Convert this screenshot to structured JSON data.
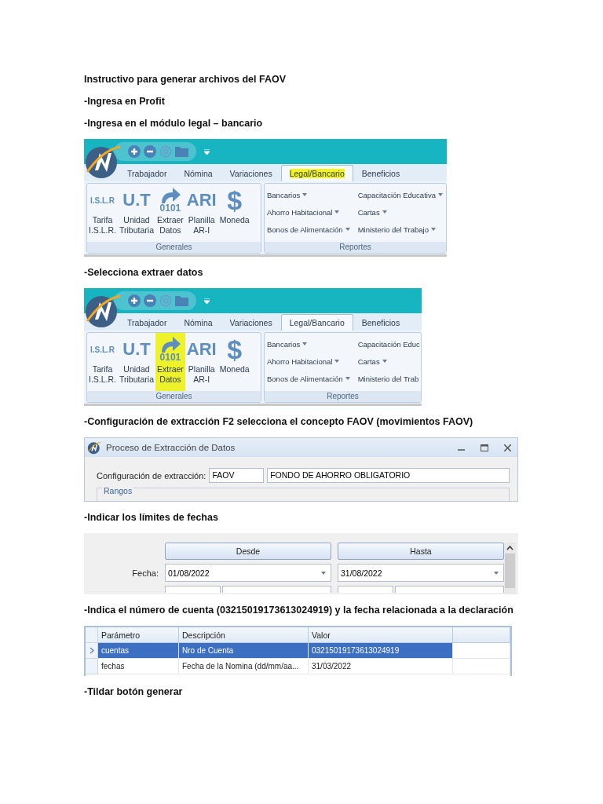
{
  "blocks": [
    {
      "kind": "text",
      "text": "Instructivo para generar archivos del FAOV"
    },
    {
      "kind": "text",
      "text": "-Ingresa en Profit"
    },
    {
      "kind": "text",
      "text": "-Ingresa en el módulo legal – bancario"
    },
    {
      "kind": "ribbon",
      "tabs": [
        {
          "label": "Trabajador",
          "selected": false,
          "highlighted": false
        },
        {
          "label": "Nómina",
          "selected": false,
          "highlighted": false
        },
        {
          "label": "Variaciones",
          "selected": false,
          "highlighted": false
        },
        {
          "label": "Legal/Bancario",
          "selected": true,
          "highlighted": true
        },
        {
          "label": "Beneficios",
          "selected": false,
          "highlighted": false
        }
      ],
      "tools_label": "Generales",
      "tools": [
        {
          "kind": "glyph",
          "glyph": "I.S.L.R",
          "lines": [
            "Tarifa",
            "I.S.L.R."
          ],
          "highlighted": false
        },
        {
          "kind": "glyph",
          "glyph": "U.T",
          "lines": [
            "Unidad",
            "Tributaria"
          ],
          "highlighted": false
        },
        {
          "kind": "arrow",
          "glyph": "0101",
          "lines": [
            "Extraer",
            "Datos"
          ],
          "highlighted": false
        },
        {
          "kind": "glyph",
          "glyph": "ARI",
          "lines": [
            "Planilla",
            "AR-I"
          ],
          "highlighted": false
        },
        {
          "kind": "glyph",
          "glyph": "$",
          "lines": [
            "Moneda"
          ],
          "highlighted": false
        }
      ],
      "menus_label": "Reportes",
      "menus": [
        {
          "label": "Bancarios",
          "dropdown": true
        },
        {
          "label": "Ahorro Habitacional",
          "dropdown": true
        },
        {
          "label": "Bonos de Alimentación",
          "dropdown": true
        },
        {
          "label": "Capacitación Educativa",
          "dropdown": true
        },
        {
          "label": "Cartas",
          "dropdown": true
        },
        {
          "label": "Ministerio del Trabajo",
          "dropdown": true
        }
      ]
    },
    {
      "kind": "text",
      "text": "-Selecciona extraer datos"
    },
    {
      "kind": "ribbon",
      "tabs": [
        {
          "label": "Trabajador",
          "selected": false,
          "highlighted": false
        },
        {
          "label": "Nómina",
          "selected": false,
          "highlighted": false
        },
        {
          "label": "Variaciones",
          "selected": false,
          "highlighted": false
        },
        {
          "label": "Legal/Bancario",
          "selected": true,
          "highlighted": false
        },
        {
          "label": "Beneficios",
          "selected": false,
          "highlighted": false
        }
      ],
      "tools_label": "Generales",
      "tools": [
        {
          "kind": "glyph",
          "glyph": "I.S.L.R",
          "lines": [
            "Tarifa",
            "I.S.L.R."
          ],
          "highlighted": false
        },
        {
          "kind": "glyph",
          "glyph": "U.T",
          "lines": [
            "Unidad",
            "Tributaria"
          ],
          "highlighted": false
        },
        {
          "kind": "arrow",
          "glyph": "0101",
          "lines": [
            "Extraer",
            "Datos"
          ],
          "highlighted": true
        },
        {
          "kind": "glyph",
          "glyph": "ARI",
          "lines": [
            "Planilla",
            "AR-I"
          ],
          "highlighted": false
        },
        {
          "kind": "glyph",
          "glyph": "$",
          "lines": [
            "Moneda"
          ],
          "highlighted": false
        }
      ],
      "menus_label": "Reportes",
      "menus": [
        {
          "label": "Bancarios",
          "dropdown": true
        },
        {
          "label": "Ahorro Habitacional",
          "dropdown": true
        },
        {
          "label": "Bonos de Alimentación",
          "dropdown": true
        },
        {
          "label": "Capacitación Educ",
          "dropdown": false
        },
        {
          "label": "Cartas",
          "dropdown": true
        },
        {
          "label": "Ministerio del Trab",
          "dropdown": false
        }
      ]
    },
    {
      "kind": "text",
      "text": "-Configuración de extracción F2 selecciona el concepto FAOV (movimientos FAOV)"
    },
    {
      "kind": "dialog",
      "title": "Proceso de Extracción de Datos",
      "field_label": "Configuración de extracción:",
      "code": "FAOV",
      "description": "FONDO DE AHORRO OBLIGATORIO",
      "group": "Rangos"
    },
    {
      "kind": "text",
      "text": "-Indicar los límites de fechas"
    },
    {
      "kind": "ranges",
      "headers": [
        "Desde",
        "Hasta"
      ],
      "rows": [
        {
          "label": "Fecha:",
          "values": [
            "01/08/2022",
            "31/08/2022"
          ]
        }
      ],
      "next_row_visible": true
    },
    {
      "kind": "text",
      "text": "-Indica el número de cuenta (03215019173613024919) y la fecha relacionada a la declaración"
    },
    {
      "kind": "table",
      "columns": [
        "Parámetro",
        "Descripción",
        "Valor"
      ],
      "rows": [
        {
          "cells": [
            "cuentas",
            "Nro de Cuenta",
            "03215019173613024919"
          ],
          "selected": true
        },
        {
          "cells": [
            "fechas",
            "Fecha de la Nomina (dd/mm/aa...",
            "31/03/2022"
          ],
          "selected": false
        }
      ]
    },
    {
      "kind": "text",
      "text": "-Tildar botón generar"
    }
  ]
}
